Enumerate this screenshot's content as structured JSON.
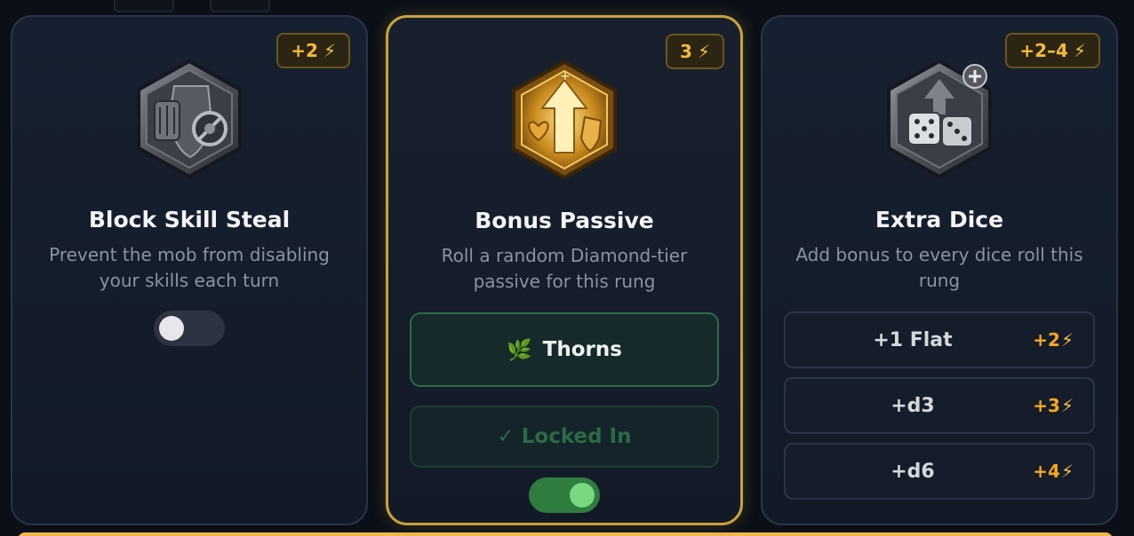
{
  "cards": [
    {
      "title": "Block Skill Steal",
      "description": "Prevent the mob from disabling your skills each turn",
      "cost": "+2",
      "icon": "shield-gauntlet-skull-icon",
      "toggle_state": "off"
    },
    {
      "title": "Bonus Passive",
      "description": "Roll a random Diamond-tier passive for this rung",
      "cost": "3",
      "icon": "gold-arrow-heart-shield-icon",
      "passive": {
        "emoji": "🌿",
        "name": "Thorns"
      },
      "locked_label": "✓ Locked In",
      "toggle_state": "on"
    },
    {
      "title": "Extra Dice",
      "description": "Add bonus to every dice roll this rung",
      "cost": "+2–4",
      "icon": "dice-plus-icon",
      "options": [
        {
          "label": "+1 Flat",
          "cost": "+2"
        },
        {
          "label": "+d3",
          "cost": "+3"
        },
        {
          "label": "+d6",
          "cost": "+4"
        }
      ]
    }
  ],
  "colors": {
    "accent_gold": "#c9a23f",
    "energy": "#f5b93e",
    "toggle_on": "#2e7d3f"
  }
}
